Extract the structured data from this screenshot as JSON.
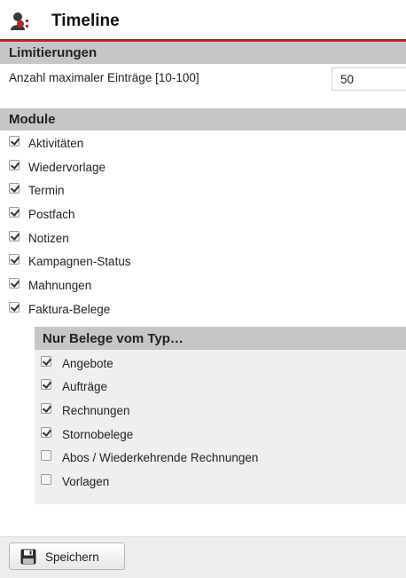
{
  "header": {
    "title": "Timeline",
    "logo_icon": "contacts-logo-icon",
    "accent": "#b22a2a"
  },
  "limits": {
    "heading": "Limitierungen",
    "max_entries_label": "Anzahl maximaler Einträge [10-100]",
    "max_entries_value": "50"
  },
  "modules": {
    "heading": "Module",
    "items": [
      {
        "label": "Aktivitäten",
        "checked": true
      },
      {
        "label": "Wiedervorlage",
        "checked": true
      },
      {
        "label": "Termin",
        "checked": true
      },
      {
        "label": "Postfach",
        "checked": true
      },
      {
        "label": "Notizen",
        "checked": true
      },
      {
        "label": "Kampagnen-Status",
        "checked": true
      },
      {
        "label": "Mahnungen",
        "checked": true
      },
      {
        "label": "Faktura-Belege",
        "checked": true
      }
    ]
  },
  "document_types": {
    "heading": "Nur Belege vom Typ…",
    "items": [
      {
        "label": "Angebote",
        "checked": true
      },
      {
        "label": "Aufträge",
        "checked": true
      },
      {
        "label": "Rechnungen",
        "checked": true
      },
      {
        "label": "Stornobelege",
        "checked": true
      },
      {
        "label": "Abos / Wiederkehrende Rechnungen",
        "checked": false
      },
      {
        "label": "Vorlagen",
        "checked": false
      }
    ]
  },
  "footer": {
    "save_label": "Speichern",
    "save_icon": "floppy-disk-icon"
  }
}
